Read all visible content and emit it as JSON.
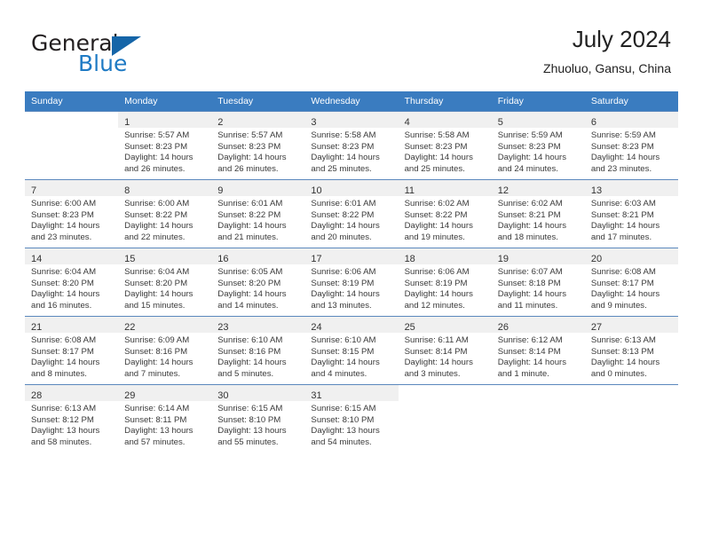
{
  "brand": {
    "name_part1": "General",
    "name_part2": "Blue",
    "accent_color": "#1e7ac4",
    "triangle_color": "#1565a8"
  },
  "header": {
    "title": "July 2024",
    "subtitle": "Zhuoluo, Gansu, China"
  },
  "calendar": {
    "header_bg": "#3a7cc0",
    "weekday_headers": [
      "Sunday",
      "Monday",
      "Tuesday",
      "Wednesday",
      "Thursday",
      "Friday",
      "Saturday"
    ],
    "weeks": [
      [
        {
          "day": "",
          "sunrise": "",
          "sunset": "",
          "daylight_line1": "",
          "daylight_line2": ""
        },
        {
          "day": "1",
          "sunrise": "Sunrise: 5:57 AM",
          "sunset": "Sunset: 8:23 PM",
          "daylight_line1": "Daylight: 14 hours",
          "daylight_line2": "and 26 minutes."
        },
        {
          "day": "2",
          "sunrise": "Sunrise: 5:57 AM",
          "sunset": "Sunset: 8:23 PM",
          "daylight_line1": "Daylight: 14 hours",
          "daylight_line2": "and 26 minutes."
        },
        {
          "day": "3",
          "sunrise": "Sunrise: 5:58 AM",
          "sunset": "Sunset: 8:23 PM",
          "daylight_line1": "Daylight: 14 hours",
          "daylight_line2": "and 25 minutes."
        },
        {
          "day": "4",
          "sunrise": "Sunrise: 5:58 AM",
          "sunset": "Sunset: 8:23 PM",
          "daylight_line1": "Daylight: 14 hours",
          "daylight_line2": "and 25 minutes."
        },
        {
          "day": "5",
          "sunrise": "Sunrise: 5:59 AM",
          "sunset": "Sunset: 8:23 PM",
          "daylight_line1": "Daylight: 14 hours",
          "daylight_line2": "and 24 minutes."
        },
        {
          "day": "6",
          "sunrise": "Sunrise: 5:59 AM",
          "sunset": "Sunset: 8:23 PM",
          "daylight_line1": "Daylight: 14 hours",
          "daylight_line2": "and 23 minutes."
        }
      ],
      [
        {
          "day": "7",
          "sunrise": "Sunrise: 6:00 AM",
          "sunset": "Sunset: 8:23 PM",
          "daylight_line1": "Daylight: 14 hours",
          "daylight_line2": "and 23 minutes."
        },
        {
          "day": "8",
          "sunrise": "Sunrise: 6:00 AM",
          "sunset": "Sunset: 8:22 PM",
          "daylight_line1": "Daylight: 14 hours",
          "daylight_line2": "and 22 minutes."
        },
        {
          "day": "9",
          "sunrise": "Sunrise: 6:01 AM",
          "sunset": "Sunset: 8:22 PM",
          "daylight_line1": "Daylight: 14 hours",
          "daylight_line2": "and 21 minutes."
        },
        {
          "day": "10",
          "sunrise": "Sunrise: 6:01 AM",
          "sunset": "Sunset: 8:22 PM",
          "daylight_line1": "Daylight: 14 hours",
          "daylight_line2": "and 20 minutes."
        },
        {
          "day": "11",
          "sunrise": "Sunrise: 6:02 AM",
          "sunset": "Sunset: 8:22 PM",
          "daylight_line1": "Daylight: 14 hours",
          "daylight_line2": "and 19 minutes."
        },
        {
          "day": "12",
          "sunrise": "Sunrise: 6:02 AM",
          "sunset": "Sunset: 8:21 PM",
          "daylight_line1": "Daylight: 14 hours",
          "daylight_line2": "and 18 minutes."
        },
        {
          "day": "13",
          "sunrise": "Sunrise: 6:03 AM",
          "sunset": "Sunset: 8:21 PM",
          "daylight_line1": "Daylight: 14 hours",
          "daylight_line2": "and 17 minutes."
        }
      ],
      [
        {
          "day": "14",
          "sunrise": "Sunrise: 6:04 AM",
          "sunset": "Sunset: 8:20 PM",
          "daylight_line1": "Daylight: 14 hours",
          "daylight_line2": "and 16 minutes."
        },
        {
          "day": "15",
          "sunrise": "Sunrise: 6:04 AM",
          "sunset": "Sunset: 8:20 PM",
          "daylight_line1": "Daylight: 14 hours",
          "daylight_line2": "and 15 minutes."
        },
        {
          "day": "16",
          "sunrise": "Sunrise: 6:05 AM",
          "sunset": "Sunset: 8:20 PM",
          "daylight_line1": "Daylight: 14 hours",
          "daylight_line2": "and 14 minutes."
        },
        {
          "day": "17",
          "sunrise": "Sunrise: 6:06 AM",
          "sunset": "Sunset: 8:19 PM",
          "daylight_line1": "Daylight: 14 hours",
          "daylight_line2": "and 13 minutes."
        },
        {
          "day": "18",
          "sunrise": "Sunrise: 6:06 AM",
          "sunset": "Sunset: 8:19 PM",
          "daylight_line1": "Daylight: 14 hours",
          "daylight_line2": "and 12 minutes."
        },
        {
          "day": "19",
          "sunrise": "Sunrise: 6:07 AM",
          "sunset": "Sunset: 8:18 PM",
          "daylight_line1": "Daylight: 14 hours",
          "daylight_line2": "and 11 minutes."
        },
        {
          "day": "20",
          "sunrise": "Sunrise: 6:08 AM",
          "sunset": "Sunset: 8:17 PM",
          "daylight_line1": "Daylight: 14 hours",
          "daylight_line2": "and 9 minutes."
        }
      ],
      [
        {
          "day": "21",
          "sunrise": "Sunrise: 6:08 AM",
          "sunset": "Sunset: 8:17 PM",
          "daylight_line1": "Daylight: 14 hours",
          "daylight_line2": "and 8 minutes."
        },
        {
          "day": "22",
          "sunrise": "Sunrise: 6:09 AM",
          "sunset": "Sunset: 8:16 PM",
          "daylight_line1": "Daylight: 14 hours",
          "daylight_line2": "and 7 minutes."
        },
        {
          "day": "23",
          "sunrise": "Sunrise: 6:10 AM",
          "sunset": "Sunset: 8:16 PM",
          "daylight_line1": "Daylight: 14 hours",
          "daylight_line2": "and 5 minutes."
        },
        {
          "day": "24",
          "sunrise": "Sunrise: 6:10 AM",
          "sunset": "Sunset: 8:15 PM",
          "daylight_line1": "Daylight: 14 hours",
          "daylight_line2": "and 4 minutes."
        },
        {
          "day": "25",
          "sunrise": "Sunrise: 6:11 AM",
          "sunset": "Sunset: 8:14 PM",
          "daylight_line1": "Daylight: 14 hours",
          "daylight_line2": "and 3 minutes."
        },
        {
          "day": "26",
          "sunrise": "Sunrise: 6:12 AM",
          "sunset": "Sunset: 8:14 PM",
          "daylight_line1": "Daylight: 14 hours",
          "daylight_line2": "and 1 minute."
        },
        {
          "day": "27",
          "sunrise": "Sunrise: 6:13 AM",
          "sunset": "Sunset: 8:13 PM",
          "daylight_line1": "Daylight: 14 hours",
          "daylight_line2": "and 0 minutes."
        }
      ],
      [
        {
          "day": "28",
          "sunrise": "Sunrise: 6:13 AM",
          "sunset": "Sunset: 8:12 PM",
          "daylight_line1": "Daylight: 13 hours",
          "daylight_line2": "and 58 minutes."
        },
        {
          "day": "29",
          "sunrise": "Sunrise: 6:14 AM",
          "sunset": "Sunset: 8:11 PM",
          "daylight_line1": "Daylight: 13 hours",
          "daylight_line2": "and 57 minutes."
        },
        {
          "day": "30",
          "sunrise": "Sunrise: 6:15 AM",
          "sunset": "Sunset: 8:10 PM",
          "daylight_line1": "Daylight: 13 hours",
          "daylight_line2": "and 55 minutes."
        },
        {
          "day": "31",
          "sunrise": "Sunrise: 6:15 AM",
          "sunset": "Sunset: 8:10 PM",
          "daylight_line1": "Daylight: 13 hours",
          "daylight_line2": "and 54 minutes."
        },
        {
          "day": "",
          "sunrise": "",
          "sunset": "",
          "daylight_line1": "",
          "daylight_line2": ""
        },
        {
          "day": "",
          "sunrise": "",
          "sunset": "",
          "daylight_line1": "",
          "daylight_line2": ""
        },
        {
          "day": "",
          "sunrise": "",
          "sunset": "",
          "daylight_line1": "",
          "daylight_line2": ""
        }
      ]
    ]
  }
}
